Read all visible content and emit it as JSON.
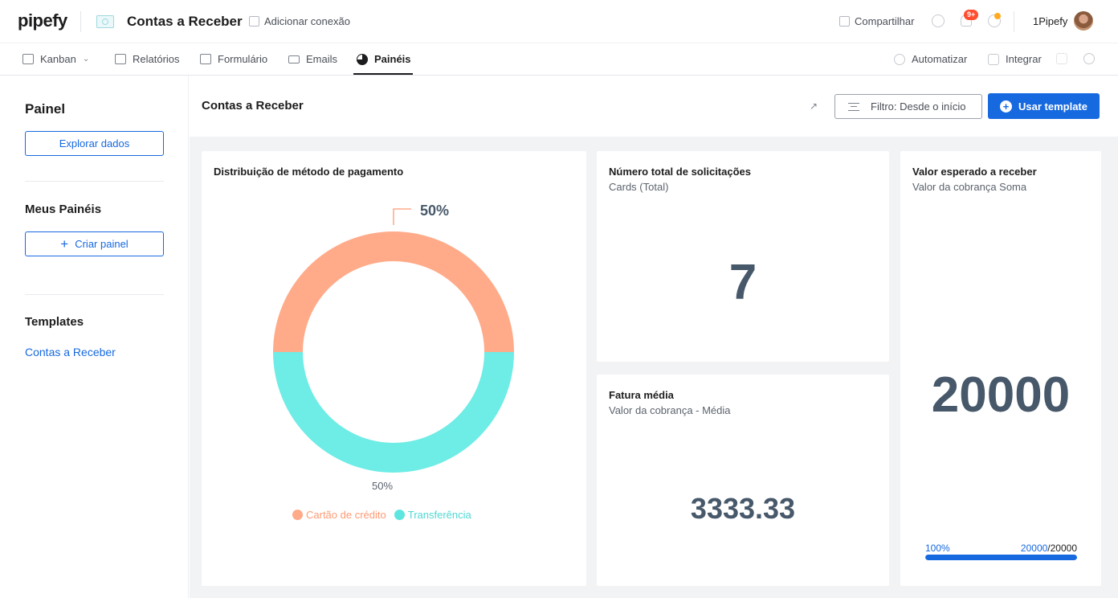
{
  "header": {
    "logo": "pipefy",
    "app_title": "Contas a Receber",
    "add_connection": "Adicionar conexão",
    "share": "Compartilhar",
    "notifications_badge": "9+",
    "username": "1Pipefy"
  },
  "nav": {
    "tabs": [
      {
        "label": "Kanban",
        "icon": "kanban-icon"
      },
      {
        "label": "Relatórios",
        "icon": "table-icon"
      },
      {
        "label": "Formulário",
        "icon": "form-icon"
      },
      {
        "label": "Emails",
        "icon": "mail-icon"
      },
      {
        "label": "Painéis",
        "icon": "pie-chart-icon",
        "active": true
      }
    ],
    "automate": "Automatizar",
    "integrate": "Integrar"
  },
  "sidebar": {
    "painel_title": "Painel",
    "explore_button": "Explorar dados",
    "my_panels_title": "Meus Painéis",
    "create_panel_button": "Criar painel",
    "templates_title": "Templates",
    "template_link": "Contas a Receber"
  },
  "main": {
    "title": "Contas a Receber",
    "filter_button": "Filtro: Desde o início",
    "use_template_button": "Usar template"
  },
  "cards": {
    "distribution": {
      "title": "Distribuição de método de pagamento"
    },
    "total_requests": {
      "title": "Número total de solicitações",
      "subtitle": "Cards (Total)",
      "value": "7"
    },
    "avg_invoice": {
      "title": "Fatura média",
      "subtitle": "Valor da cobrança - Média",
      "value": "3333.33"
    },
    "expected_value": {
      "title": "Valor esperado a receber",
      "subtitle": "Valor da cobrança Soma",
      "value": "20000",
      "progress_percent_label": "100%",
      "progress_current": "20000",
      "progress_total": "/20000",
      "progress_fraction": 1.0
    }
  },
  "chart_data": {
    "type": "pie",
    "categories": [
      "Cartão de crédito",
      "Transferência"
    ],
    "values": [
      50,
      50
    ],
    "labels": [
      "50%",
      "50%"
    ],
    "colors": [
      "#ffab8a",
      "#6eece6"
    ],
    "legend_position": "bottom"
  }
}
